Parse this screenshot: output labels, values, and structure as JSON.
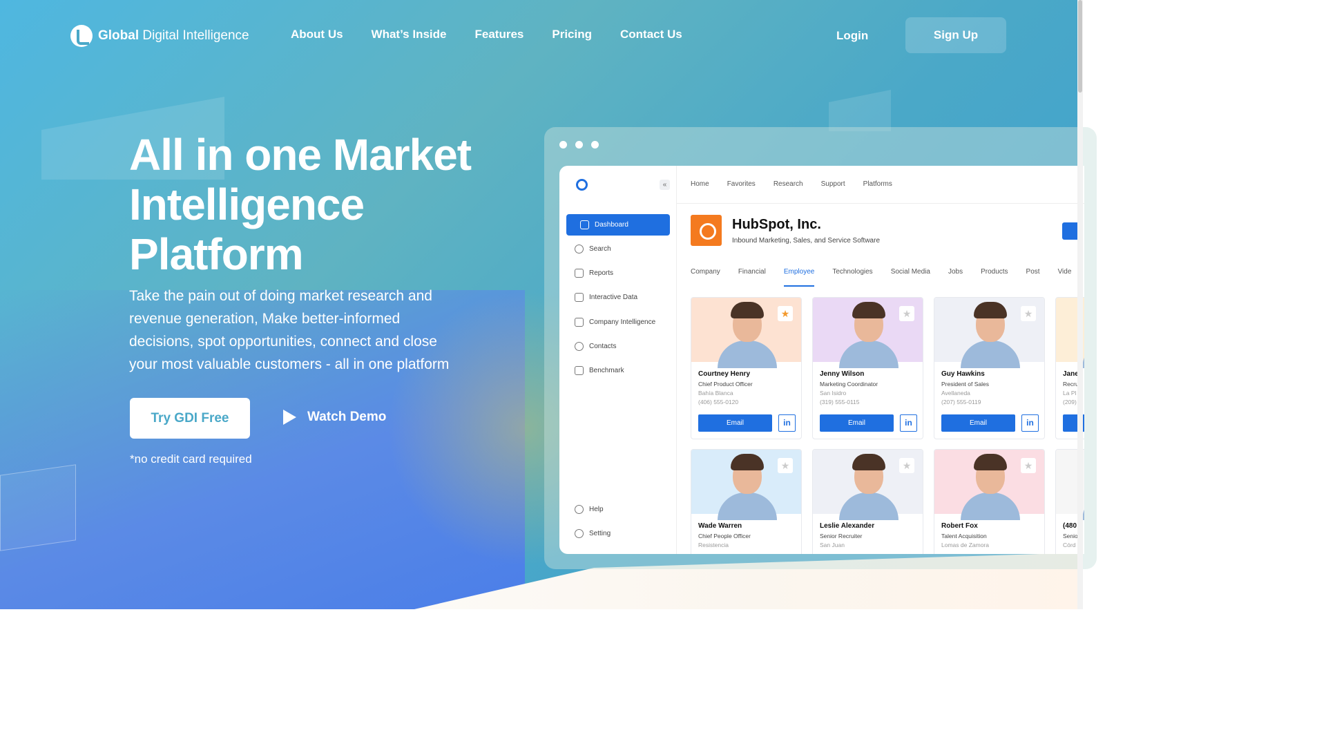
{
  "nav": {
    "logo_bold": "Global",
    "logo_rest": " Digital Intelligence",
    "links": [
      "About Us",
      "What’s Inside",
      "Features",
      "Pricing",
      "Contact Us"
    ],
    "login": "Login",
    "signup": "Sign Up"
  },
  "hero": {
    "headline": "All in one Market Intelligence Platform",
    "subtext": "Take the pain out of doing market research and revenue generation, Make better-informed decisions, spot opportunities, connect and close your most valuable customers - all in one platform",
    "try_button": "Try GDI Free",
    "watch_demo": "Watch Demo",
    "no_credit": "*no credit card required"
  },
  "dashboard": {
    "sidebar": {
      "items": [
        "Dashboard",
        "Search",
        "Reports",
        "Interactive Data",
        "Company Intelligence",
        "Contacts",
        "Benchmark"
      ],
      "footer_items": [
        "Help",
        "Setting"
      ],
      "active": "Dashboard",
      "collapse_glyph": "«"
    },
    "topnav": [
      "Home",
      "Favorites",
      "Research",
      "Support",
      "Platforms"
    ],
    "company": {
      "name": "HubSpot, Inc.",
      "description": "Inbound Marketing, Sales, and Service Software"
    },
    "tabs": [
      "Company",
      "Financial",
      "Employee",
      "Technologies",
      "Social Media",
      "Jobs",
      "Products",
      "Post",
      "Vide"
    ],
    "active_tab": "Employee",
    "email_label": "Email",
    "linkedin_label": "in",
    "star_glyph": "★",
    "contacts": [
      {
        "name": "Courtney Henry",
        "title": "Chief Product Officer",
        "location": "Bahía Blanca",
        "phone": "(406) 555-0120",
        "starred": true,
        "bg": "#fde2d2"
      },
      {
        "name": "Jenny Wilson",
        "title": "Marketing Coordinator",
        "location": "San Isidro",
        "phone": "(319) 555-0115",
        "starred": false,
        "bg": "#ead9f5"
      },
      {
        "name": "Guy Hawkins",
        "title": "President of Sales",
        "location": "Avellaneda",
        "phone": "(207) 555-0119",
        "starred": false,
        "bg": "#eef0f6"
      },
      {
        "name": "Jane",
        "title": "Recru",
        "location": "La Pl",
        "phone": "(209)",
        "starred": false,
        "bg": "#fdeed7"
      },
      {
        "name": "Wade Warren",
        "title": "Chief People Officer",
        "location": "Resistencia",
        "phone": "",
        "starred": false,
        "bg": "#d9ecfa"
      },
      {
        "name": "Leslie Alexander",
        "title": "Senior Recruiter",
        "location": "San Juan",
        "phone": "",
        "starred": false,
        "bg": "#eef0f6"
      },
      {
        "name": "Robert Fox",
        "title": "Talent Acquisition",
        "location": "Lomas de Zamora",
        "phone": "",
        "starred": false,
        "bg": "#fbdde3"
      },
      {
        "name": "(480",
        "title": "Senio",
        "location": "Córd",
        "phone": "",
        "starred": false,
        "bg": "#f6f6f6"
      }
    ]
  },
  "colors": {
    "accent": "#1f6fe0",
    "hubspot_orange": "#f47a1f",
    "star_on": "#f39a2e"
  }
}
